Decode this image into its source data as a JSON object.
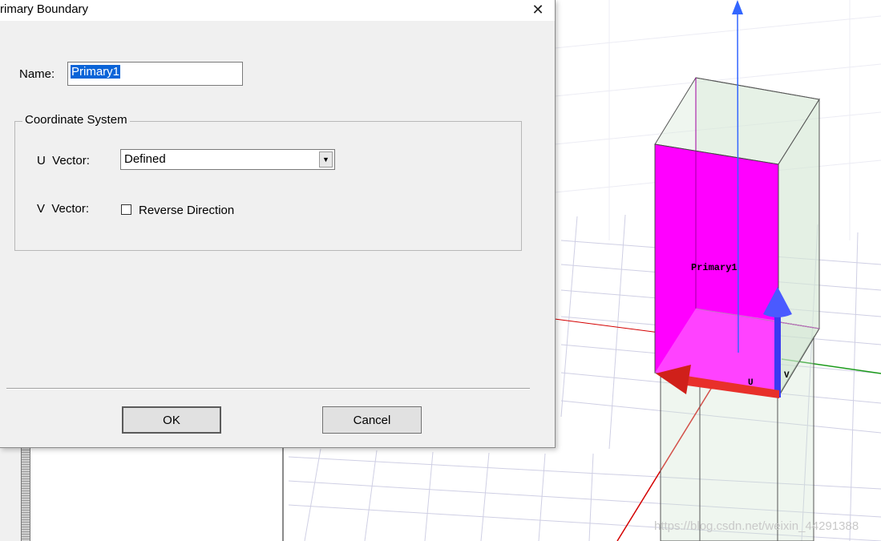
{
  "dialog": {
    "title": "rimary Boundary",
    "name_label": "Name:",
    "name_value": "Primary1",
    "coordinate_group_label": "Coordinate System",
    "u_vector_label": "U  Vector:",
    "u_vector_selected": "Defined",
    "v_vector_label": "V  Vector:",
    "reverse_direction_label": "Reverse Direction",
    "reverse_direction_checked": false,
    "ok_label": "OK",
    "cancel_label": "Cancel"
  },
  "viewport": {
    "face_label": "Primary1",
    "u_label": "U",
    "v_label": "V",
    "colors": {
      "face": "#ff00ff",
      "u_arrow": "#e8302a",
      "v_arrow": "#3a3af0",
      "x_axis": "#d40000",
      "y_axis": "#1a9a1a",
      "z_axis": "#3366ff",
      "grid": "#c8c8e0"
    }
  },
  "watermark": "https://blog.csdn.net/weixin_44291388"
}
